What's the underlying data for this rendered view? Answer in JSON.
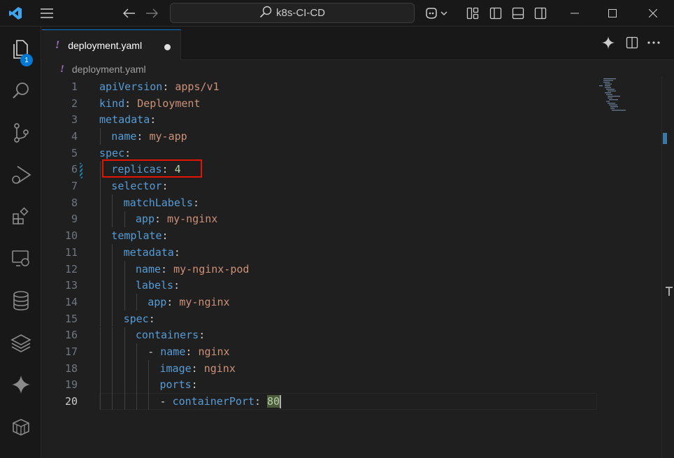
{
  "titlebar": {
    "search_text": "k8s-CI-CD",
    "icons": [
      "vscode-logo-icon",
      "menu-icon",
      "back-arrow-icon",
      "forward-arrow-icon",
      "search-icon",
      "copilot-icon",
      "chevron-down-icon",
      "customize-layout-icon",
      "toggle-primary-sidebar-icon",
      "toggle-panel-icon",
      "toggle-secondary-sidebar-icon",
      "minimize-icon",
      "maximize-icon",
      "close-icon"
    ]
  },
  "activitybar": {
    "explorer_badge": "1",
    "items": [
      "explorer-icon",
      "search-icon",
      "source-control-icon",
      "run-debug-icon",
      "extensions-icon",
      "remote-explorer-icon",
      "database-icon",
      "layers-icon",
      "copilot-sparkle-icon",
      "containers-icon"
    ]
  },
  "tab": {
    "file_icon": "!",
    "label": "deployment.yaml"
  },
  "breadcrumb": {
    "file_icon": "!",
    "label": "deployment.yaml"
  },
  "editor": {
    "active_line": "20",
    "lines": [
      {
        "n": "1",
        "indent": 0,
        "key": "apiVersion",
        "value": "apps/v1",
        "kind": "s"
      },
      {
        "n": "2",
        "indent": 0,
        "key": "kind",
        "value": "Deployment",
        "kind": "s"
      },
      {
        "n": "3",
        "indent": 0,
        "key": "metadata",
        "value": "",
        "kind": ""
      },
      {
        "n": "4",
        "indent": 1,
        "key": "name",
        "value": "my-app",
        "kind": "s"
      },
      {
        "n": "5",
        "indent": 0,
        "key": "spec",
        "value": "",
        "kind": ""
      },
      {
        "n": "6",
        "indent": 1,
        "key": "replicas",
        "value": "4",
        "kind": "n"
      },
      {
        "n": "7",
        "indent": 1,
        "key": "selector",
        "value": "",
        "kind": ""
      },
      {
        "n": "8",
        "indent": 2,
        "key": "matchLabels",
        "value": "",
        "kind": ""
      },
      {
        "n": "9",
        "indent": 3,
        "key": "app",
        "value": "my-nginx",
        "kind": "s"
      },
      {
        "n": "10",
        "indent": 1,
        "key": "template",
        "value": "",
        "kind": ""
      },
      {
        "n": "11",
        "indent": 2,
        "key": "metadata",
        "value": "",
        "kind": ""
      },
      {
        "n": "12",
        "indent": 3,
        "key": "name",
        "value": "my-nginx-pod",
        "kind": "s"
      },
      {
        "n": "13",
        "indent": 3,
        "key": "labels",
        "value": "",
        "kind": ""
      },
      {
        "n": "14",
        "indent": 4,
        "key": "app",
        "value": "my-nginx",
        "kind": "s"
      },
      {
        "n": "15",
        "indent": 2,
        "key": "spec",
        "value": "",
        "kind": ""
      },
      {
        "n": "16",
        "indent": 3,
        "key": "containers",
        "value": "",
        "kind": ""
      },
      {
        "n": "17",
        "indent": 4,
        "dash": true,
        "key": "name",
        "value": "nginx",
        "kind": "s"
      },
      {
        "n": "18",
        "indent": 5,
        "key": "image",
        "value": "nginx",
        "kind": "s"
      },
      {
        "n": "19",
        "indent": 5,
        "key": "ports",
        "value": "",
        "kind": ""
      },
      {
        "n": "20",
        "indent": 5,
        "dash": true,
        "key": "containerPort",
        "value": "80",
        "kind": "n"
      }
    ]
  },
  "highlight": {
    "line": "6",
    "color": "#e51400"
  }
}
